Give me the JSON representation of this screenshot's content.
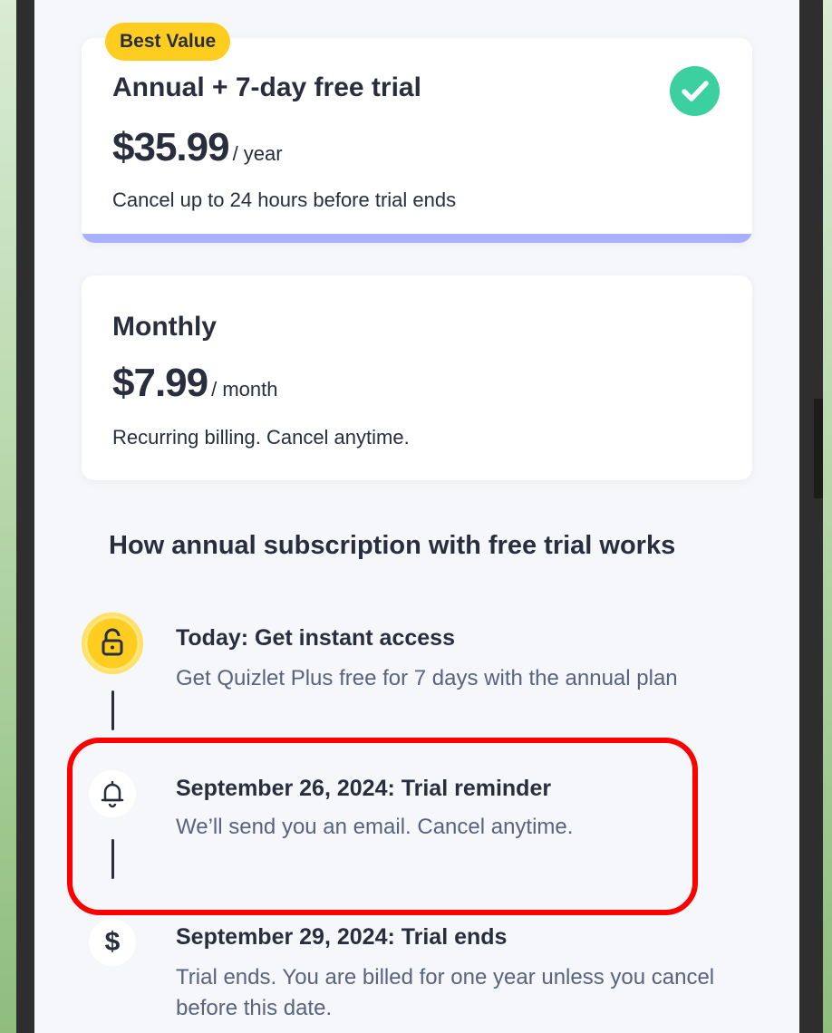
{
  "plans": [
    {
      "badge": "Best Value",
      "title": "Annual + 7-day free trial",
      "price": "$35.99",
      "period": "/ year",
      "note": "Cancel up to 24 hours before trial ends",
      "selected": true
    },
    {
      "title": "Monthly",
      "price": "$7.99",
      "period": "/ month",
      "note": "Recurring billing. Cancel anytime.",
      "selected": false
    }
  ],
  "how_it_works": {
    "heading": "How annual subscription with free trial works",
    "steps": [
      {
        "icon": "lock-icon",
        "title": "Today: Get instant access",
        "description": "Get Quizlet Plus free for 7 days with the annual plan"
      },
      {
        "icon": "bell-icon",
        "title": "September 26, 2024: Trial reminder",
        "description": "We’ll send you an email. Cancel anytime."
      },
      {
        "icon": "dollar-icon",
        "title": "September 29, 2024: Trial ends",
        "description": "Trial ends. You are billed for one year unless you cancel before this date."
      }
    ]
  },
  "colors": {
    "accent_yellow": "#ffcd1f",
    "check_green": "#3ccfa0",
    "selected_bar": "#a8b1ff",
    "highlight_red": "#ff0000",
    "text_dark": "#282e3e",
    "text_muted": "#586380"
  }
}
